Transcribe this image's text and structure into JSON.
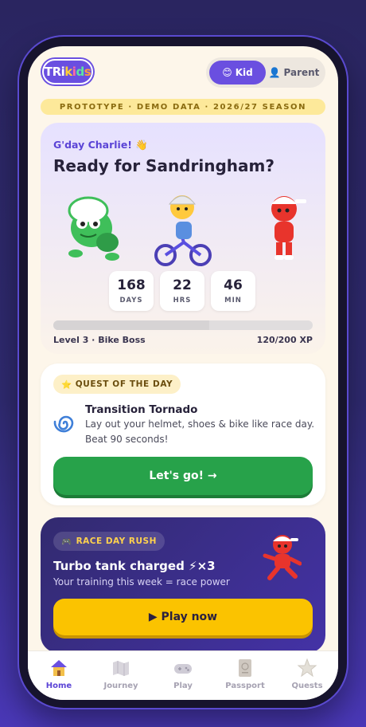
{
  "header": {
    "logo": {
      "part1": "TRi",
      "k1": "k",
      "k2": "i",
      "k3": "d",
      "k4": "s"
    },
    "modes": [
      {
        "label": "Kid",
        "icon": "kid-face-icon",
        "active": true
      },
      {
        "label": "Parent",
        "icon": "parent-person-icon",
        "active": false
      }
    ]
  },
  "banner": "PROTOTYPE · DEMO DATA · 2026/27 SEASON",
  "hero": {
    "greeting": "G'day Charlie! 👋",
    "headline": "Ready for Sandringham?",
    "countdown": [
      {
        "value": "168",
        "label": "DAYS"
      },
      {
        "value": "22",
        "label": "HRS"
      },
      {
        "value": "46",
        "label": "MIN"
      }
    ],
    "level_text": "Level 3 · Bike Boss",
    "xp_text": "120/200 XP",
    "xp_fraction": 0.6
  },
  "quest": {
    "tag": "QUEST OF THE DAY",
    "tag_icon": "star-icon",
    "title": "Transition Tornado",
    "description": "Lay out your helmet, shoes & bike like race day. Beat 90 seconds!",
    "icon": "cyclone-icon",
    "button": "Let's go! →"
  },
  "race": {
    "tag": "RACE DAY RUSH",
    "tag_icon": "gamepad-icon",
    "title": "Turbo tank charged ⚡×3",
    "subtitle": "Your training this week = race power",
    "button": "▶ Play now"
  },
  "tabs": [
    {
      "label": "Home",
      "icon": "house-icon",
      "active": true
    },
    {
      "label": "Journey",
      "icon": "map-icon",
      "active": false
    },
    {
      "label": "Play",
      "icon": "gamepad-icon",
      "active": false
    },
    {
      "label": "Passport",
      "icon": "passport-icon",
      "active": false
    },
    {
      "label": "Quests",
      "icon": "star-icon",
      "active": false
    }
  ],
  "colors": {
    "accent": "#6a4fe0",
    "go": "#27a24a",
    "play": "#fbc300",
    "background": "#2a2560"
  }
}
